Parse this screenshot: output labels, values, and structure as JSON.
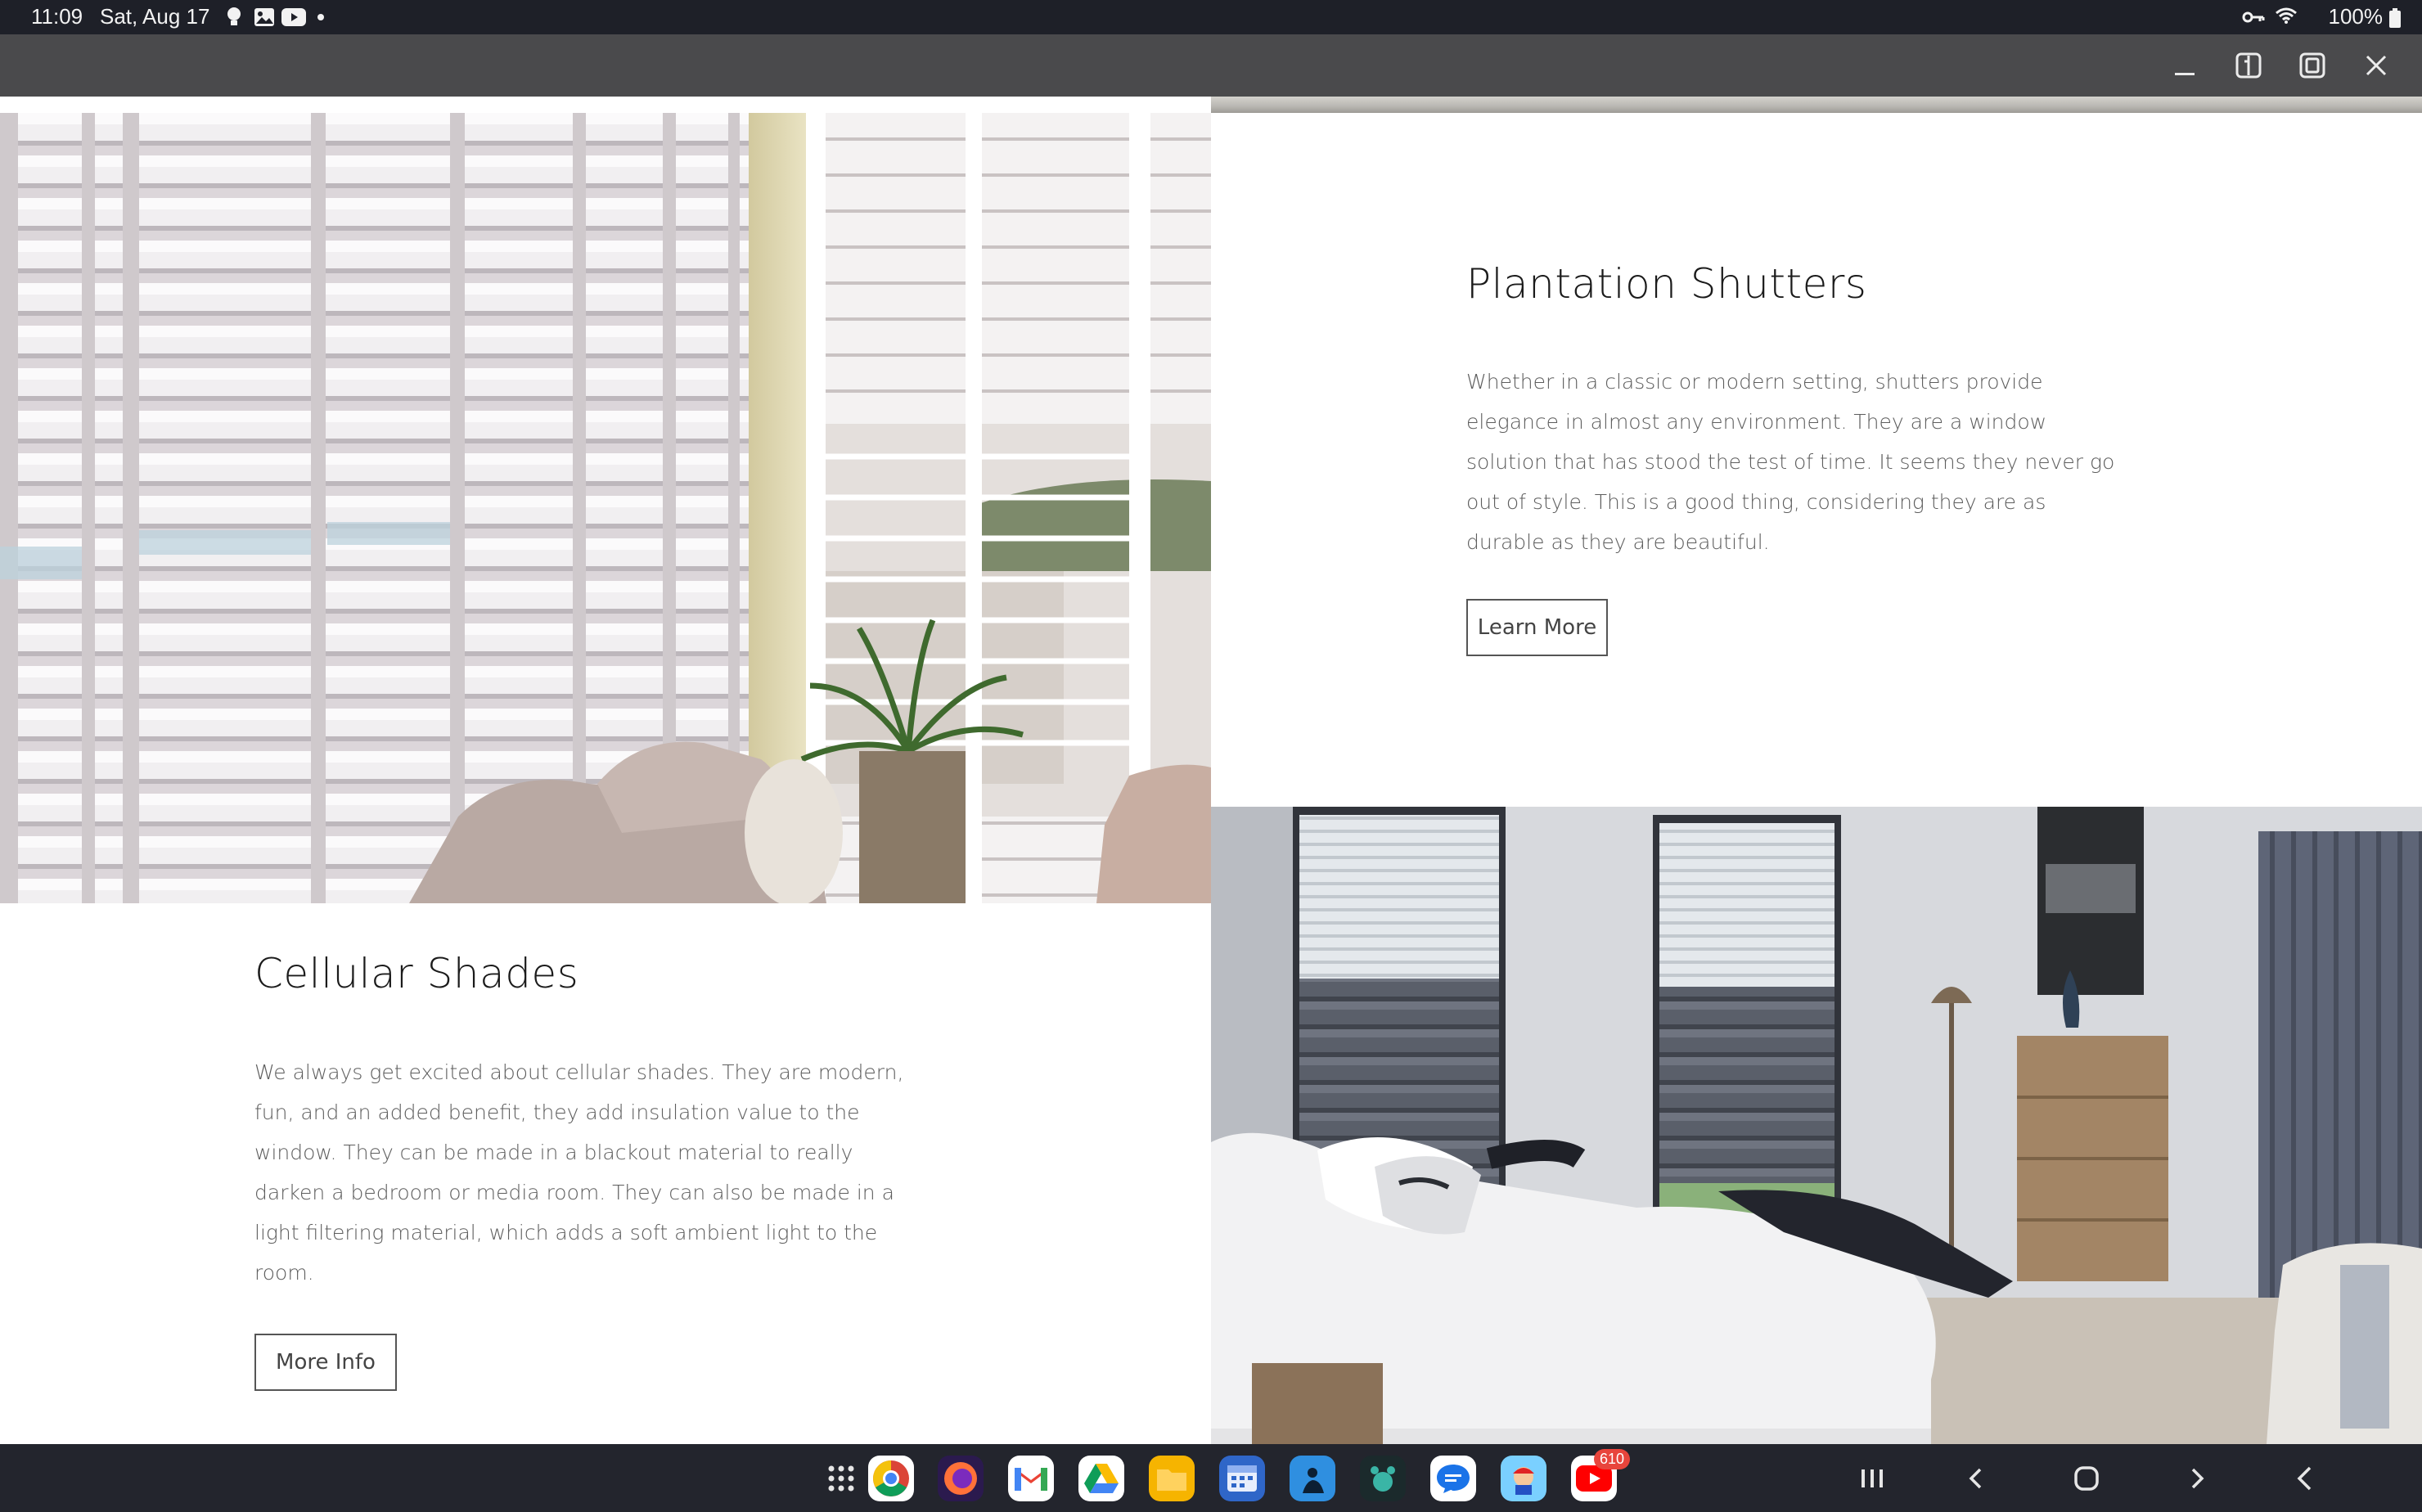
{
  "status_bar": {
    "time": "11:09",
    "date": "Sat, Aug 17",
    "notification_icons": [
      "bulb-icon",
      "gallery-icon",
      "youtube-icon",
      "dot-icon"
    ],
    "system_icons": [
      "vpn-key-icon",
      "wifi-icon",
      "battery-icon"
    ],
    "battery": "100%"
  },
  "caption_bar": {
    "buttons": [
      "minimize-icon",
      "split-screen-icon",
      "maximize-icon",
      "close-icon"
    ]
  },
  "sections": {
    "shutters": {
      "title": "Plantation Shutters",
      "body": "Whether in a classic or modern setting, shutters provide elegance in almost any environment. They are a window solution that has stood the test of time. It seems they never go out of style. This is a good thing, considering they are as durable as they are beautiful.",
      "button": "Learn More"
    },
    "cellular": {
      "title": "Cellular Shades",
      "body": "We always get excited about cellular shades. They are modern, fun, and an added benefit, they add insulation value to the window. They can be made in a blackout material to really darken a bedroom or media room. They can also be made in a light filtering material, which adds a soft ambient light to the room.",
      "button": "More Info"
    }
  },
  "taskbar": {
    "apps": [
      "app-drawer-icon",
      "chrome-icon",
      "firefox-icon",
      "gmail-icon",
      "drive-icon",
      "files-icon",
      "calendar-icon",
      "kindle-icon",
      "game-icon",
      "messages-icon",
      "mario-game-icon",
      "youtube-icon"
    ],
    "youtube_badge": "610",
    "nav": [
      "recents-icon",
      "back-chevron-icon",
      "home-icon",
      "forward-chevron-icon",
      "back-icon"
    ]
  },
  "colors": {
    "status_bar_bg": "#1e2028",
    "caption_bar_bg": "#4a4a4c",
    "taskbar_bg": "#23252d",
    "heading_text": "#1b1b1b",
    "body_text": "#5d5d5d"
  }
}
